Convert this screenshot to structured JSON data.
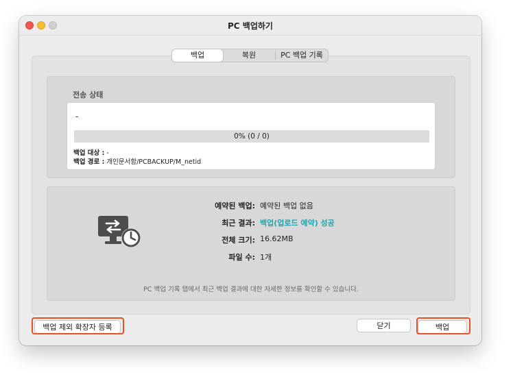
{
  "window": {
    "title": "PC 백업하기"
  },
  "tabs": [
    {
      "label": "백업",
      "active": true
    },
    {
      "label": "복원",
      "active": false
    },
    {
      "label": "PC 백업 기록",
      "active": false
    }
  ],
  "status": {
    "heading": "전송 상태",
    "current_file": "-",
    "progress_percent": 0,
    "progress_text": "0% (0 / 0)",
    "target_label": "백업 대상 :",
    "target_value": "-",
    "path_label": "백업 경로 :",
    "path_value": "개인문서함/PCBACKUP/M_netid"
  },
  "summary": {
    "icon": "backup-monitor-clock-icon",
    "rows": [
      {
        "label": "예약된 백업:",
        "value": "예약된 백업 없음"
      },
      {
        "label": "최근 결과:",
        "value": "백업(업로드 예약) 성공"
      },
      {
        "label": "전체 크기:",
        "value": "16.62MB"
      },
      {
        "label": "파일 수:",
        "value": "1개"
      }
    ],
    "hint": "PC 백업 기록 탭에서 최근 백업 결과에 대한 자세한 정보를 확인할 수 있습니다."
  },
  "buttons": {
    "exclude_ext": "백업 제외 확장자 등록",
    "close": "닫기",
    "backup": "백업"
  },
  "colors": {
    "success": "#17a9b3",
    "highlight": "#e8502a",
    "window_bg": "#ececec"
  }
}
